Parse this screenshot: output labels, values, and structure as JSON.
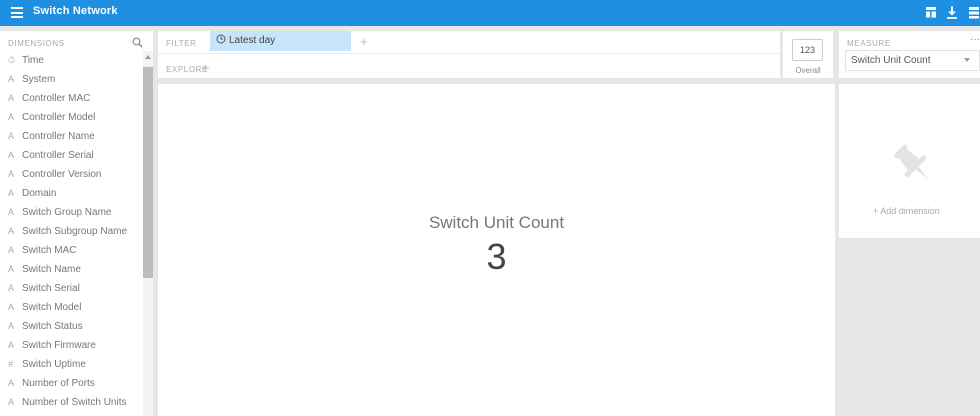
{
  "app": {
    "title": "Switch Network"
  },
  "dimensions": {
    "header": "DIMENSIONS",
    "items": [
      {
        "icon": "clock",
        "glyph": "⏱",
        "label": "Time"
      },
      {
        "icon": "string",
        "glyph": "A",
        "label": "System"
      },
      {
        "icon": "string",
        "glyph": "A",
        "label": "Controller MAC"
      },
      {
        "icon": "string",
        "glyph": "A",
        "label": "Controller Model"
      },
      {
        "icon": "string",
        "glyph": "A",
        "label": "Controller Name"
      },
      {
        "icon": "string",
        "glyph": "A",
        "label": "Controller Serial"
      },
      {
        "icon": "string",
        "glyph": "A",
        "label": "Controller Version"
      },
      {
        "icon": "string",
        "glyph": "A",
        "label": "Domain"
      },
      {
        "icon": "string",
        "glyph": "A",
        "label": "Switch Group Name"
      },
      {
        "icon": "string",
        "glyph": "A",
        "label": "Switch Subgroup Name"
      },
      {
        "icon": "string",
        "glyph": "A",
        "label": "Switch MAC"
      },
      {
        "icon": "string",
        "glyph": "A",
        "label": "Switch Name"
      },
      {
        "icon": "string",
        "glyph": "A",
        "label": "Switch Serial"
      },
      {
        "icon": "string",
        "glyph": "A",
        "label": "Switch Model"
      },
      {
        "icon": "string",
        "glyph": "A",
        "label": "Switch Status"
      },
      {
        "icon": "string",
        "glyph": "A",
        "label": "Switch Firmware"
      },
      {
        "icon": "number",
        "glyph": "#",
        "label": "Switch Uptime"
      },
      {
        "icon": "string",
        "glyph": "A",
        "label": "Number of Ports"
      },
      {
        "icon": "string",
        "glyph": "A",
        "label": "Number of Switch Units"
      }
    ]
  },
  "filter": {
    "label": "FILTER",
    "chip": "Latest day",
    "add": "+"
  },
  "explore": {
    "label": "EXPLORE",
    "add": "+"
  },
  "visualization": {
    "icon_text": "123",
    "label": "Overall"
  },
  "measure": {
    "header": "MEASURE",
    "more": "···",
    "selected": "Switch Unit Count"
  },
  "main": {
    "title": "Switch Unit Count",
    "value": "3"
  },
  "pinboard": {
    "add_label": "+  Add dimension"
  },
  "colors": {
    "topbar": "#1e8fe1",
    "chip": "#c6e4fa",
    "background": "#e6e6e6"
  }
}
